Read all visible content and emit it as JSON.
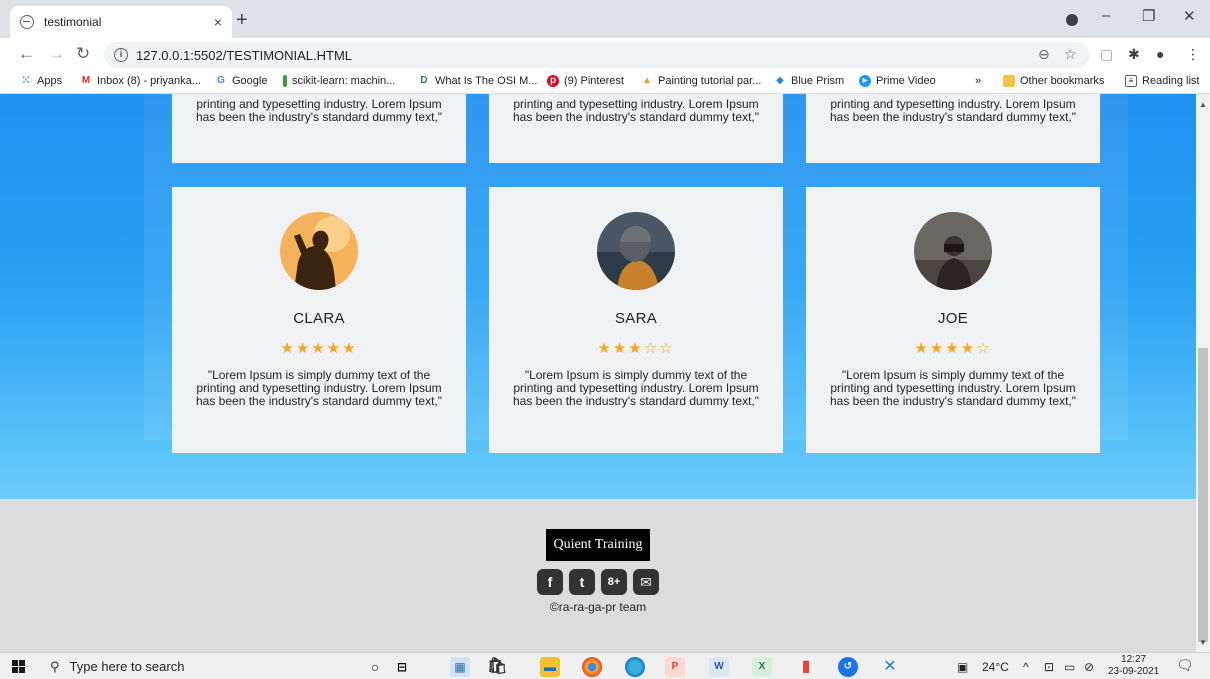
{
  "browser": {
    "tab_title": "testimonial",
    "tab_close": "×",
    "new_tab": "+",
    "url": "127.0.0.1:5502/TESTIMONIAL.HTML",
    "win_min": "–",
    "win_max": "❐",
    "win_close": "✕"
  },
  "bookmarks": {
    "apps": "Apps",
    "items": [
      {
        "label": "Inbox (8) - priyanka...",
        "icon": "gmail-icon"
      },
      {
        "label": "Google",
        "icon": "google-icon"
      },
      {
        "label": "scikit-learn: machin...",
        "icon": "scikit-icon"
      },
      {
        "label": "What Is The OSI M...",
        "icon": "osi-icon"
      },
      {
        "label": "(9) Pinterest",
        "icon": "pinterest-icon"
      },
      {
        "label": "Painting tutorial par...",
        "icon": "painting-icon"
      },
      {
        "label": "Blue Prism",
        "icon": "blueprism-icon"
      },
      {
        "label": "Prime Video",
        "icon": "primevideo-icon"
      }
    ],
    "overflow": "»",
    "other": "Other bookmarks",
    "reading": "Reading list"
  },
  "page": {
    "top_cards": [
      {
        "text": "printing and typesetting industry. Lorem Ipsum has been the industry's standard dummy text,\""
      },
      {
        "text": "printing and typesetting industry. Lorem Ipsum has been the industry's standard dummy text,\""
      },
      {
        "text": "printing and typesetting industry. Lorem Ipsum has been the industry's standard dummy text,\""
      }
    ],
    "cards": [
      {
        "name": "CLARA",
        "rating": 5,
        "stars": "★★★★★",
        "text": "\"Lorem Ipsum is simply dummy text of the printing and typesetting industry. Lorem Ipsum has been the industry's standard dummy text,\""
      },
      {
        "name": "SARA",
        "rating": 3,
        "stars": "★★★☆☆",
        "text": "\"Lorem Ipsum is simply dummy text of the printing and typesetting industry. Lorem Ipsum has been the industry's standard dummy text,\""
      },
      {
        "name": "JOE",
        "rating": 4,
        "stars": "★★★★☆",
        "text": "\"Lorem Ipsum is simply dummy text of the printing and typesetting industry. Lorem Ipsum has been the industry's standard dummy text,\""
      }
    ],
    "footer": {
      "brand": "Quient Training",
      "socials": [
        {
          "icon": "facebook-icon",
          "glyph": "f"
        },
        {
          "icon": "twitter-icon",
          "glyph": "t"
        },
        {
          "icon": "googleplus-icon",
          "glyph": "8+"
        },
        {
          "icon": "email-icon",
          "glyph": "✉"
        }
      ],
      "copyright": "©ra-ra-ga-pr team"
    }
  },
  "taskbar": {
    "search_placeholder": "Type here to search",
    "weather": "24°C",
    "time": "12:27",
    "date": "23-09-2021"
  },
  "colors": {
    "star": "#f5a623",
    "card_bg": "#f0f1f3",
    "footer_bg": "#dcdcdc",
    "sky_top": "#1e90f0",
    "sky_bottom": "#a9e3fb"
  }
}
